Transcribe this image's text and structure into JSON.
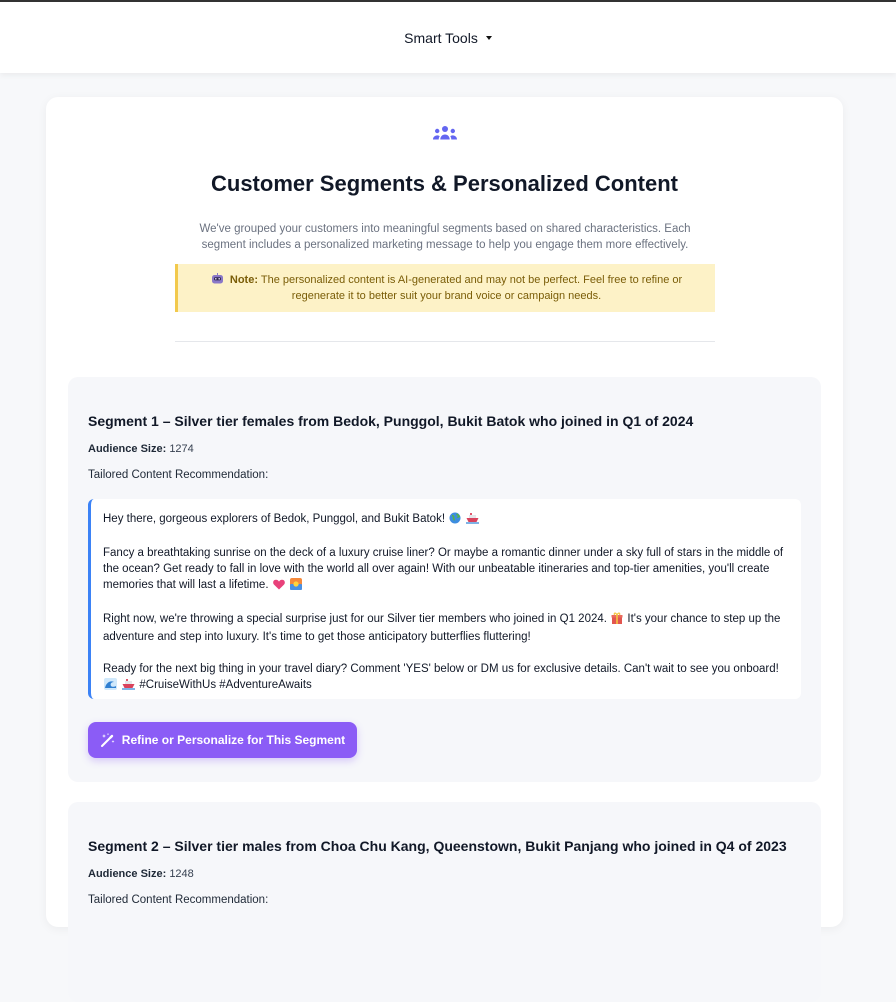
{
  "nav": {
    "menu_label": "Smart Tools"
  },
  "page": {
    "title": "Customer Segments & Personalized Content",
    "intro": "We've grouped your customers into meaningful segments based on shared characteristics. Each segment includes a personalized marketing message to help you engage them more effectively.",
    "note_label": "Note:",
    "note_text": "The personalized content is AI-generated and may not be perfect. Feel free to refine or regenerate it to better suit your brand voice or campaign needs."
  },
  "segments": [
    {
      "number_label": "Segment 1",
      "title": "– Silver tier females from Bedok, Punggol, Bukit Batok who joined in Q1 of 2024",
      "audience_label": "Audience Size:",
      "audience_size": "1274",
      "tailored_label": "Tailored Content Recommendation:",
      "paragraphs": [
        "Hey there, gorgeous explorers of Bedok, Punggol, and Bukit Batok!",
        "Fancy a breathtaking sunrise on the deck of a luxury cruise liner? Or maybe a romantic dinner under a sky full of stars in the middle of the ocean? Get ready to fall in love with the world all over again! With our unbeatable itineraries and top-tier amenities, you'll create memories that will last a lifetime.",
        "Right now, we're throwing a special surprise just for our Silver tier members who joined in Q1 2024.",
        "It's your chance to step up the adventure and step into luxury. It's time to get those anticipatory butterflies fluttering!",
        "Ready for the next big thing in your travel diary? Comment 'YES' below or DM us for exclusive details. Can't wait to see you onboard!",
        "#CruiseWithUs #AdventureAwaits"
      ],
      "button_label": "Refine or Personalize for This Segment"
    },
    {
      "number_label": "Segment 2",
      "title": "– Silver tier males from Choa Chu Kang, Queenstown, Bukit Panjang who joined in Q4 of 2023",
      "audience_label": "Audience Size:",
      "audience_size": "1248",
      "tailored_label": "Tailored Content Recommendation:"
    }
  ],
  "icons": {
    "header": "users-group-icon",
    "note": "robot-icon",
    "button": "magic-wand-icon"
  },
  "colors": {
    "accent_purple": "#8b5cf6",
    "header_icon": "#6366f1",
    "note_bg": "#fdf2c7",
    "note_border": "#f2c94c",
    "content_border": "#3b82f6"
  }
}
